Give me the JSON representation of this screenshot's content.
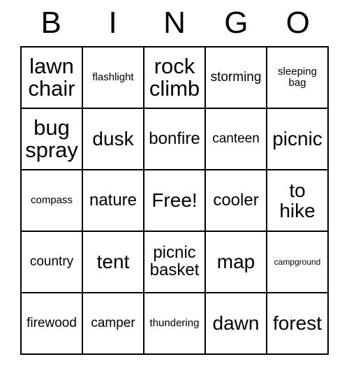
{
  "card": {
    "title_letters": [
      "B",
      "I",
      "N",
      "G",
      "O"
    ],
    "columns": 5,
    "rows": 5,
    "free_space_label": "Free!",
    "border_color": "#000000",
    "background_color": "#ffffff",
    "text_color": "#000000",
    "cells": [
      {
        "text": "lawn chair",
        "size": "s-xl"
      },
      {
        "text": "flashlight",
        "size": "s-xs"
      },
      {
        "text": "rock climb",
        "size": "s-xl"
      },
      {
        "text": "storming",
        "size": "s-sm"
      },
      {
        "text": "sleeping bag",
        "size": "s-xs"
      },
      {
        "text": "bug spray",
        "size": "s-xl"
      },
      {
        "text": "dusk",
        "size": "s-lg"
      },
      {
        "text": "bonfire",
        "size": "s-md"
      },
      {
        "text": "canteen",
        "size": "s-sm"
      },
      {
        "text": "picnic",
        "size": "s-lg"
      },
      {
        "text": "compass",
        "size": "s-xs"
      },
      {
        "text": "nature",
        "size": "s-md"
      },
      {
        "text": "Free!",
        "size": "s-lg"
      },
      {
        "text": "cooler",
        "size": "s-md"
      },
      {
        "text": "to hike",
        "size": "s-lg"
      },
      {
        "text": "country",
        "size": "s-sm"
      },
      {
        "text": "tent",
        "size": "s-lg"
      },
      {
        "text": "picnic basket",
        "size": "s-md"
      },
      {
        "text": "map",
        "size": "s-lg"
      },
      {
        "text": "campground",
        "size": "s-xxs"
      },
      {
        "text": "firewood",
        "size": "s-sm"
      },
      {
        "text": "camper",
        "size": "s-sm"
      },
      {
        "text": "thundering",
        "size": "s-xs"
      },
      {
        "text": "dawn",
        "size": "s-lg"
      },
      {
        "text": "forest",
        "size": "s-lg"
      }
    ]
  }
}
